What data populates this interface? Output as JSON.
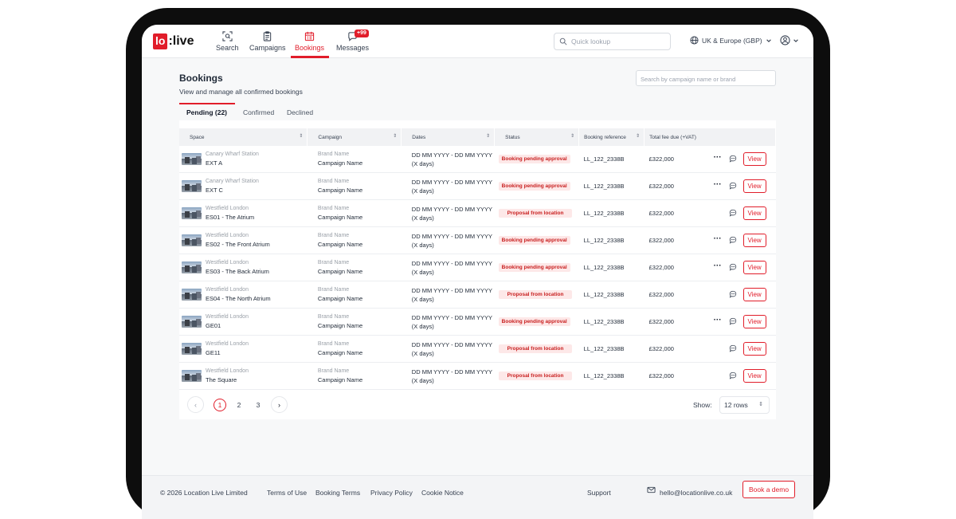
{
  "brand": {
    "logo_box": "lo",
    "logo_rest": ":live"
  },
  "nav": [
    {
      "label": "Search",
      "icon": "search-scan-icon"
    },
    {
      "label": "Campaigns",
      "icon": "clipboard-icon"
    },
    {
      "label": "Bookings",
      "icon": "calendar-list-icon",
      "active": true
    },
    {
      "label": "Messages",
      "icon": "chat-bubble-icon",
      "badge": "+99"
    }
  ],
  "quick_lookup": {
    "placeholder": "Quick lookup"
  },
  "region": {
    "label": "UK & Europe (GBP)"
  },
  "page": {
    "title": "Bookings",
    "subtitle": "View and manage all confirmed bookings",
    "search_placeholder": "Search by campaign name or brand"
  },
  "tabs": [
    {
      "label": "Pending (22)",
      "active": true
    },
    {
      "label": "Confirmed"
    },
    {
      "label": "Declined"
    }
  ],
  "table": {
    "columns": [
      "Space",
      "Campaign",
      "Dates",
      "Status",
      "Booking reference",
      "Total fee due (+VAT)"
    ],
    "rows": [
      {
        "location": "Canary Wharf Station",
        "space": "EXT A",
        "brand": "Brand Name",
        "campaign": "Campaign Name",
        "dates": "DD MM YYYY - DD MM YYYY",
        "duration": "(X days)",
        "status": "Booking pending approval",
        "ref": "LL_122_2338B",
        "fee": "£322,000",
        "more": true
      },
      {
        "location": "Canary Wharf Station",
        "space": "EXT C",
        "brand": "Brand Name",
        "campaign": "Campaign Name",
        "dates": "DD MM YYYY - DD MM YYYY",
        "duration": "(X days)",
        "status": "Booking pending approval",
        "ref": "LL_122_2338B",
        "fee": "£322,000",
        "more": true
      },
      {
        "location": "Westfield London",
        "space": "ES01 - The Atrium",
        "brand": "Brand Name",
        "campaign": "Campaign Name",
        "dates": "DD MM YYYY - DD MM YYYY",
        "duration": "(X days)",
        "status": "Proposal from location",
        "ref": "LL_122_2338B",
        "fee": "£322,000",
        "more": false
      },
      {
        "location": "Westfield London",
        "space": "ES02 - The Front Atrium",
        "brand": "Brand Name",
        "campaign": "Campaign Name",
        "dates": "DD MM YYYY - DD MM YYYY",
        "duration": "(X days)",
        "status": "Booking pending approval",
        "ref": "LL_122_2338B",
        "fee": "£322,000",
        "more": true
      },
      {
        "location": "Westfield London",
        "space": "ES03 - The Back Atrium",
        "brand": "Brand Name",
        "campaign": "Campaign Name",
        "dates": "DD MM YYYY - DD MM YYYY",
        "duration": "(X days)",
        "status": "Booking pending approval",
        "ref": "LL_122_2338B",
        "fee": "£322,000",
        "more": true
      },
      {
        "location": "Westfield London",
        "space": "ES04 - The North Atrium",
        "brand": "Brand Name",
        "campaign": "Campaign Name",
        "dates": "DD MM YYYY - DD MM YYYY",
        "duration": "(X days)",
        "status": "Proposal from location",
        "ref": "LL_122_2338B",
        "fee": "£322,000",
        "more": false
      },
      {
        "location": "Westfield London",
        "space": "GE01",
        "brand": "Brand Name",
        "campaign": "Campaign Name",
        "dates": "DD MM YYYY - DD MM YYYY",
        "duration": "(X days)",
        "status": "Booking pending approval",
        "ref": "LL_122_2338B",
        "fee": "£322,000",
        "more": true
      },
      {
        "location": "Westfield London",
        "space": "GE11",
        "brand": "Brand Name",
        "campaign": "Campaign Name",
        "dates": "DD MM YYYY - DD MM YYYY",
        "duration": "(X days)",
        "status": "Proposal from location",
        "ref": "LL_122_2338B",
        "fee": "£322,000",
        "more": false
      },
      {
        "location": "Westfield London",
        "space": "The Square",
        "brand": "Brand Name",
        "campaign": "Campaign Name",
        "dates": "DD MM YYYY - DD MM YYYY",
        "duration": "(X days)",
        "status": "Proposal from location",
        "ref": "LL_122_2338B",
        "fee": "£322,000",
        "more": false
      }
    ],
    "view_label": "View"
  },
  "pagination": {
    "pages": [
      "1",
      "2",
      "3"
    ],
    "current": "1",
    "show_label": "Show:",
    "rows_value": "12 rows"
  },
  "footer": {
    "copyright": "© 2026 Location Live Limited",
    "links": [
      "Terms of Use",
      "Booking Terms",
      "Privacy Policy",
      "Cookie Notice"
    ],
    "support": "Support",
    "email": "hello@locationlive.co.uk",
    "demo_button": "Book a demo"
  },
  "colors": {
    "accent": "#e11d2a",
    "status_bg": "#fde8e8",
    "page_bg": "#f7f8f9"
  }
}
